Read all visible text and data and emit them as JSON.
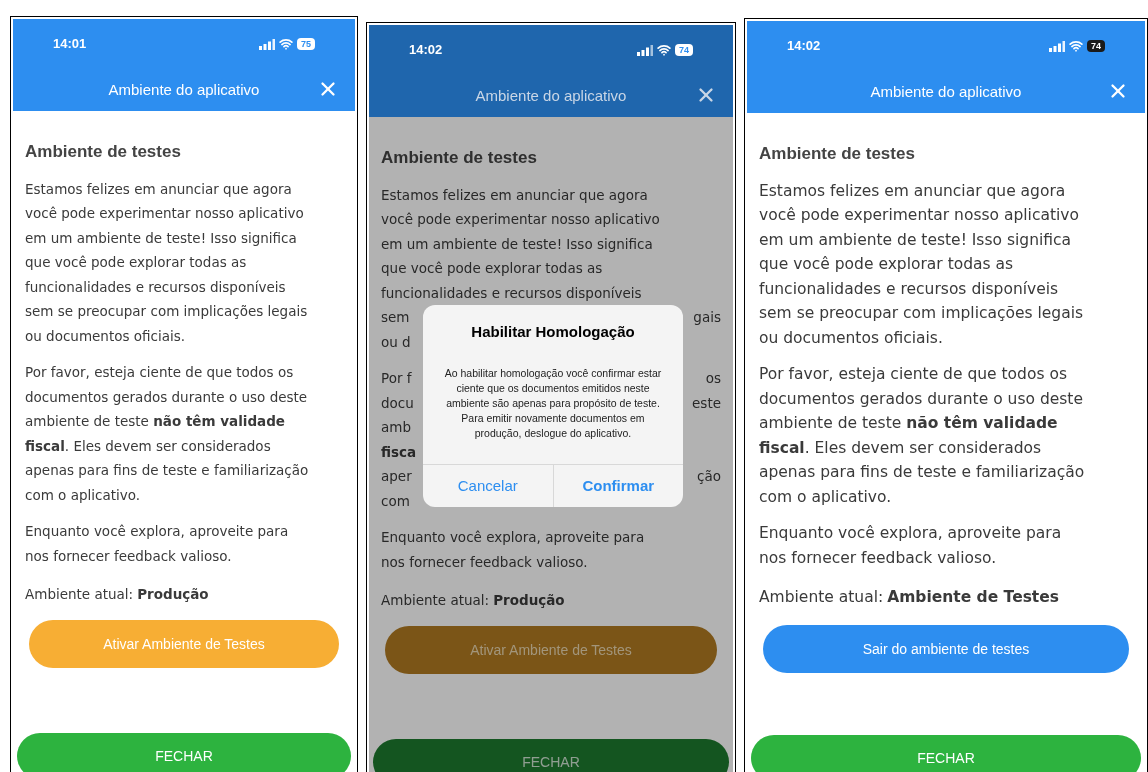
{
  "screens": [
    {
      "dimmed": false,
      "status": {
        "time": "14:01",
        "battery": "75",
        "battery_dark": false
      },
      "header": {
        "title": "Ambiente do aplicativo"
      },
      "heading": "Ambiente de testes",
      "paragraphs": [
        [
          [
            "Estamos felizes em anunciar que agora"
          ],
          [
            "você pode experimentar nosso aplicativo"
          ],
          [
            "em um ambiente de teste! Isso significa"
          ],
          [
            "que você pode explorar todas as"
          ],
          [
            "funcionalidades e recursos disponíveis"
          ],
          [
            "sem se preocupar com implicações legais"
          ],
          [
            "ou documentos oficiais."
          ]
        ],
        [
          [
            "Por favor, esteja ciente de que todos os"
          ],
          [
            "documentos gerados durante o uso deste"
          ],
          [
            "ambiente de teste **não têm validade**"
          ],
          [
            "**fiscal**. Eles devem ser considerados"
          ],
          [
            "apenas para fins de teste e familiarização"
          ],
          [
            "com o aplicativo."
          ]
        ],
        [
          [
            "Enquanto você explora, aproveite para"
          ],
          [
            "nos fornecer feedback valioso."
          ]
        ]
      ],
      "env_label": "Ambiente atual:",
      "env_value": "Produção",
      "action": {
        "label": "Ativar Ambiente de Testes",
        "kind": "activate"
      },
      "close_label": "FECHAR"
    },
    {
      "dimmed": true,
      "status": {
        "time": "14:02",
        "battery": "74",
        "battery_dark": false
      },
      "header": {
        "title": "Ambiente do aplicativo"
      },
      "heading": "Ambiente de testes",
      "paragraphs": [
        [
          [
            "Estamos felizes em anunciar que agora"
          ],
          [
            "você pode experimentar nosso aplicativo"
          ],
          [
            "em um ambiente de teste! Isso significa"
          ],
          [
            "que você pode explorar todas as"
          ],
          [
            "funcionalidades e recursos disponíveis"
          ],
          [
            "sem",
            "gais"
          ],
          [
            "ou d"
          ]
        ],
        [
          [
            "Por f",
            "os"
          ],
          [
            "docu",
            "este"
          ],
          [
            "amb"
          ],
          [
            "**fisca**"
          ],
          [
            "aper",
            "ção"
          ],
          [
            "com"
          ]
        ],
        [
          [
            "Enquanto você explora, aproveite para"
          ],
          [
            "nos fornecer feedback valioso."
          ]
        ]
      ],
      "env_label": "Ambiente atual:",
      "env_value": "Produção",
      "action": {
        "label": "Ativar Ambiente de Testes",
        "kind": "activate"
      },
      "close_label": "FECHAR",
      "dialog": {
        "title": "Habilitar Homologação",
        "message": "Ao habilitar homologação você confirmar estar ciente que os documentos emitidos neste ambiente são apenas para propósito de teste. Para emitir novamente documentos em produção, deslogue do aplicativo.",
        "buttons": [
          {
            "label": "Cancelar",
            "bold": false
          },
          {
            "label": "Confirmar",
            "bold": true
          }
        ]
      }
    },
    {
      "dimmed": false,
      "status": {
        "time": "14:02",
        "battery": "74",
        "battery_dark": true
      },
      "header": {
        "title": "Ambiente do aplicativo"
      },
      "heading": "Ambiente de testes",
      "paragraphs": [
        [
          [
            "Estamos felizes em anunciar que agora"
          ],
          [
            "você pode experimentar nosso aplicativo"
          ],
          [
            "em um ambiente de teste! Isso significa"
          ],
          [
            "que você pode explorar todas as"
          ],
          [
            "funcionalidades e recursos disponíveis"
          ],
          [
            "sem se preocupar com implicações legais"
          ],
          [
            "ou documentos oficiais."
          ]
        ],
        [
          [
            "Por favor, esteja ciente de que todos os"
          ],
          [
            "documentos gerados durante o uso deste"
          ],
          [
            "ambiente de teste **não têm validade**"
          ],
          [
            "**fiscal**. Eles devem ser considerados"
          ],
          [
            "apenas para fins de teste e familiarização"
          ],
          [
            "com o aplicativo."
          ]
        ],
        [
          [
            "Enquanto você explora, aproveite para"
          ],
          [
            "nos fornecer feedback valioso."
          ]
        ]
      ],
      "env_label": "Ambiente atual:",
      "env_value": "Ambiente de Testes",
      "action": {
        "label": "Sair do ambiente de testes",
        "kind": "exit"
      },
      "close_label": "FECHAR"
    }
  ]
}
